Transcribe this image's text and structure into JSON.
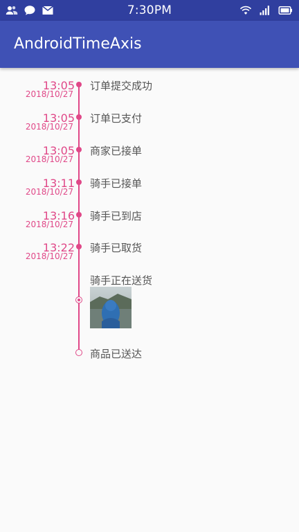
{
  "status_bar": {
    "time": "7:30PM",
    "icons_left": [
      "person-icon",
      "chat-icon",
      "mail-icon"
    ],
    "icons_right": [
      "wifi-icon",
      "signal-icon",
      "battery-icon"
    ]
  },
  "app_bar": {
    "title": "AndroidTimeAxis"
  },
  "timeline": {
    "color": "#e04888",
    "items": [
      {
        "time": "13:05",
        "date": "2018/10/27",
        "label": "订单提交成功"
      },
      {
        "time": "13:05",
        "date": "2018/10/27",
        "label": "订单已支付"
      },
      {
        "time": "13:05",
        "date": "2018/10/27",
        "label": "商家已接单"
      },
      {
        "time": "13:11",
        "date": "2018/10/27",
        "label": "骑手已接单"
      },
      {
        "time": "13:16",
        "date": "2018/10/27",
        "label": "骑手已到店"
      },
      {
        "time": "13:22",
        "date": "2018/10/27",
        "label": "骑手已取货"
      }
    ],
    "in_progress_label": "骑手正在送货",
    "final_label": "商品已送达"
  }
}
